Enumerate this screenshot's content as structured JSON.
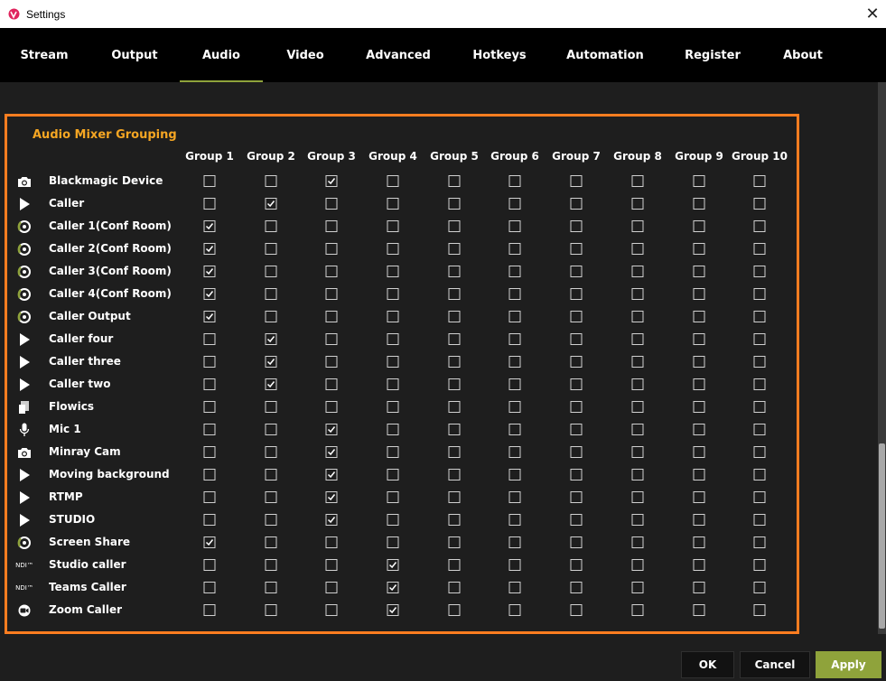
{
  "window": {
    "title": "Settings",
    "close_glyph": "✕"
  },
  "tabs": [
    {
      "label": "Stream",
      "active": false
    },
    {
      "label": "Output",
      "active": false
    },
    {
      "label": "Audio",
      "active": true
    },
    {
      "label": "Video",
      "active": false
    },
    {
      "label": "Advanced",
      "active": false
    },
    {
      "label": "Hotkeys",
      "active": false
    },
    {
      "label": "Automation",
      "active": false
    },
    {
      "label": "Register",
      "active": false
    },
    {
      "label": "About",
      "active": false
    }
  ],
  "section": {
    "title": "Audio Mixer Grouping"
  },
  "groups": [
    "Group 1",
    "Group 2",
    "Group 3",
    "Group 4",
    "Group 5",
    "Group 6",
    "Group 7",
    "Group 8",
    "Group 9",
    "Group 10"
  ],
  "sources": [
    {
      "label": "Blackmagic Device",
      "icon": "camera-icon",
      "group": 3
    },
    {
      "label": "Caller",
      "icon": "play-icon",
      "group": 2
    },
    {
      "label": "Caller 1(Conf Room)",
      "icon": "vmix-call-icon",
      "group": 1
    },
    {
      "label": "Caller 2(Conf Room)",
      "icon": "vmix-call-icon",
      "group": 1
    },
    {
      "label": "Caller 3(Conf Room)",
      "icon": "vmix-call-icon",
      "group": 1
    },
    {
      "label": "Caller 4(Conf Room)",
      "icon": "vmix-call-icon",
      "group": 1
    },
    {
      "label": "Caller Output",
      "icon": "vmix-call-icon",
      "group": 1
    },
    {
      "label": "Caller four",
      "icon": "play-icon",
      "group": 2
    },
    {
      "label": "Caller three",
      "icon": "play-icon",
      "group": 2
    },
    {
      "label": "Caller two",
      "icon": "play-icon",
      "group": 2
    },
    {
      "label": "Flowics",
      "icon": "document-icon",
      "group": 0
    },
    {
      "label": "Mic 1",
      "icon": "microphone-icon",
      "group": 3
    },
    {
      "label": "Minray Cam",
      "icon": "camera-icon",
      "group": 3
    },
    {
      "label": "Moving background",
      "icon": "play-icon",
      "group": 3
    },
    {
      "label": "RTMP",
      "icon": "play-icon",
      "group": 3
    },
    {
      "label": "STUDIO",
      "icon": "play-icon",
      "group": 3
    },
    {
      "label": "Screen Share",
      "icon": "vmix-call-icon",
      "group": 1
    },
    {
      "label": "Studio caller",
      "icon": "ndi-icon",
      "group": 4
    },
    {
      "label": "Teams Caller",
      "icon": "ndi-icon",
      "group": 4
    },
    {
      "label": "Zoom Caller",
      "icon": "video-camera-icon",
      "group": 4
    }
  ],
  "icon_text": {
    "ndi": "NDI™"
  },
  "buttons": {
    "ok": "OK",
    "cancel": "Cancel",
    "apply": "Apply"
  },
  "colors": {
    "accent": "#ff7d20",
    "section_title": "#f5a623",
    "apply": "#8fa33b"
  }
}
